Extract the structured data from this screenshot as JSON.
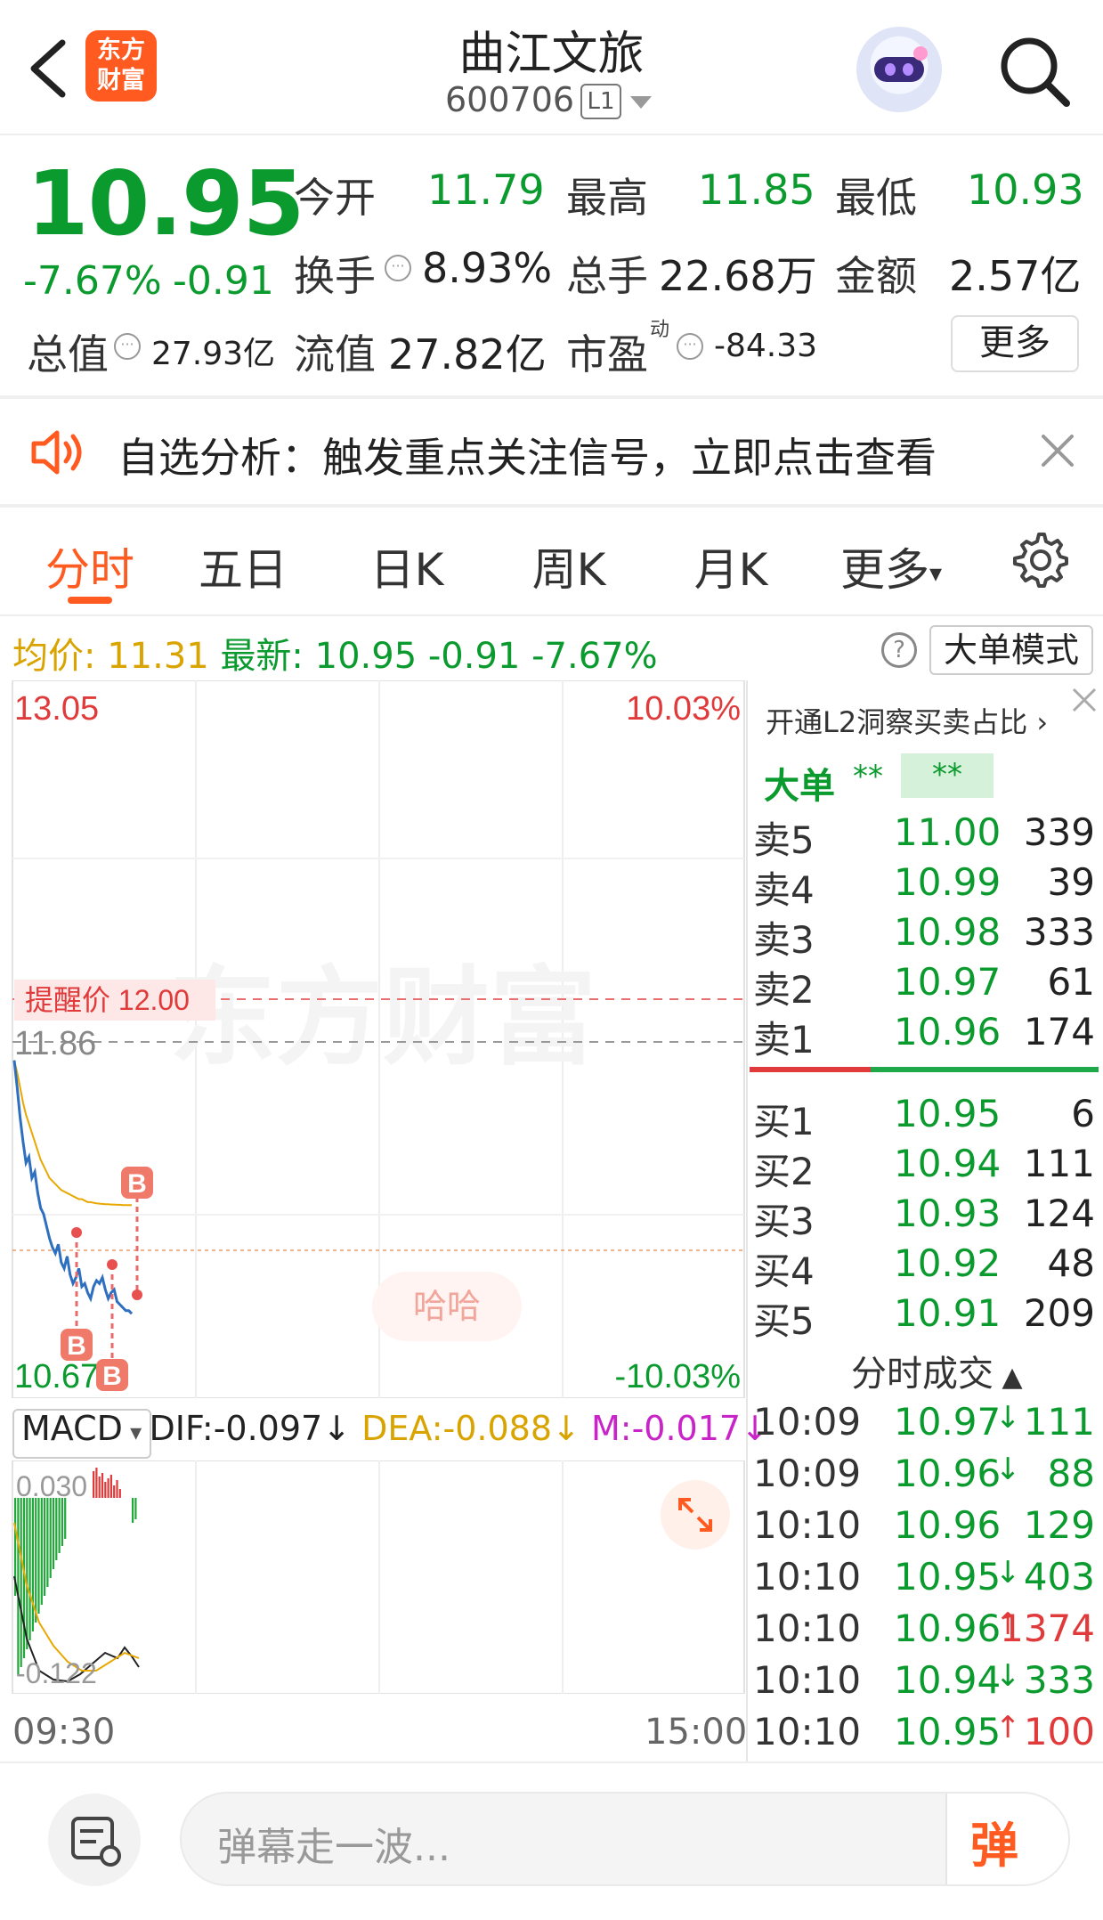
{
  "header": {
    "title": "曲江文旅",
    "code": "600706",
    "level": "L1",
    "logo_text_1": "东方",
    "logo_text_2": "财富"
  },
  "quote": {
    "price": "10.95",
    "change_pct": "-7.67%",
    "change_abs": "-0.91",
    "open_label": "今开",
    "open": "11.79",
    "high_label": "最高",
    "high": "11.85",
    "low_label": "最低",
    "low": "10.93",
    "turnover_label": "换手",
    "turnover": "8.93%",
    "volume_label": "总手",
    "volume": "22.68万",
    "amount_label": "金额",
    "amount": "2.57亿",
    "mktcap_label": "总值",
    "mktcap": "27.93亿",
    "float_label": "流值",
    "float": "27.82亿",
    "pe_label": "市盈",
    "pe_sup": "动",
    "pe": "-84.33",
    "more_label": "更多"
  },
  "alert": {
    "text": "自选分析：触发重点关注信号，立即点击查看"
  },
  "tabs": [
    "分时",
    "五日",
    "日K",
    "周K",
    "月K",
    "更多"
  ],
  "info": {
    "avg_label": "均价:",
    "avg": "11.31",
    "latest_label": "最新:",
    "latest": "10.95",
    "latest_chg": "-0.91",
    "latest_pct": "-7.67%",
    "mode_btn": "大单模式"
  },
  "chart": {
    "y_top": "13.05",
    "y_bottom": "10.67",
    "pct_top": "10.03%",
    "pct_bottom": "-10.03%",
    "alert_price_label": "提醒价 12.00",
    "prev_close_label": "11.86",
    "watermark": "东方财富",
    "haha_label": "哈哈",
    "marker_label": "B",
    "time_start": "09:30",
    "time_end": "15:00"
  },
  "chart_data": {
    "type": "line",
    "x": [
      "09:30",
      "09:31",
      "09:32",
      "09:33",
      "09:34",
      "09:35",
      "09:36",
      "09:37",
      "09:38",
      "09:39",
      "09:40",
      "09:41",
      "09:42",
      "09:43",
      "09:44",
      "09:45",
      "09:46",
      "09:47",
      "09:48",
      "09:49",
      "09:50",
      "09:51",
      "09:52",
      "09:53",
      "09:54",
      "09:55",
      "09:56",
      "09:57",
      "09:58",
      "09:59",
      "10:00",
      "10:01",
      "10:02",
      "10:03",
      "10:04",
      "10:05",
      "10:06",
      "10:07",
      "10:08",
      "10:09",
      "10:10"
    ],
    "series": [
      {
        "values": [
          11.79,
          11.7,
          11.6,
          11.52,
          11.45,
          11.47,
          11.4,
          11.42,
          11.35,
          11.3,
          11.28,
          11.24,
          11.2,
          11.17,
          11.15,
          11.18,
          11.12,
          11.1,
          11.14,
          11.08,
          11.05,
          11.07,
          11.1,
          11.04,
          11.05,
          11.02,
          11.0,
          11.04,
          11.06,
          11.05,
          11.07,
          11.03,
          11.0,
          11.02,
          11.03,
          10.99,
          10.98,
          10.97,
          10.96,
          10.96,
          10.95
        ]
      },
      {
        "values": [
          11.79,
          11.75,
          11.7,
          11.65,
          11.61,
          11.58,
          11.55,
          11.52,
          11.49,
          11.46,
          11.44,
          11.42,
          11.4,
          11.39,
          11.38,
          11.37,
          11.36,
          11.355,
          11.35,
          11.345,
          11.34,
          11.335,
          11.33,
          11.33,
          11.325,
          11.32,
          11.32,
          11.318,
          11.316,
          11.315,
          11.314,
          11.313,
          11.313,
          11.312,
          11.312,
          11.311,
          11.311,
          11.31,
          11.31,
          11.31,
          11.31
        ]
      }
    ],
    "ylim": [
      10.67,
      13.05
    ],
    "reference_lines": {
      "prev_close": 11.86,
      "alert_price": 12.0
    }
  },
  "macd": {
    "selector": "MACD",
    "dif": "DIF:-0.097",
    "dea": "DEA:-0.088",
    "m": "M:-0.017",
    "top": "0.030",
    "bottom": "-0.122"
  },
  "orderbook": {
    "header": "开通L2洞察买卖占比",
    "dadan_label": "大单",
    "dadan_v1": "**",
    "dadan_v2": "**",
    "asks": [
      {
        "label": "卖5",
        "price": "11.00",
        "vol": "339"
      },
      {
        "label": "卖4",
        "price": "10.99",
        "vol": "39"
      },
      {
        "label": "卖3",
        "price": "10.98",
        "vol": "333"
      },
      {
        "label": "卖2",
        "price": "10.97",
        "vol": "61"
      },
      {
        "label": "卖1",
        "price": "10.96",
        "vol": "174"
      }
    ],
    "bids": [
      {
        "label": "买1",
        "price": "10.95",
        "vol": "6"
      },
      {
        "label": "买2",
        "price": "10.94",
        "vol": "111"
      },
      {
        "label": "买3",
        "price": "10.93",
        "vol": "124"
      },
      {
        "label": "买4",
        "price": "10.92",
        "vol": "48"
      },
      {
        "label": "买5",
        "price": "10.91",
        "vol": "209"
      }
    ]
  },
  "trades": {
    "title": "分时成交",
    "rows": [
      {
        "time": "10:09",
        "price": "10.97",
        "dir": "↓",
        "vol": "111"
      },
      {
        "time": "10:09",
        "price": "10.96",
        "dir": "↓",
        "vol": "88"
      },
      {
        "time": "10:10",
        "price": "10.96",
        "dir": "",
        "vol": "129"
      },
      {
        "time": "10:10",
        "price": "10.95",
        "dir": "↓",
        "vol": "403"
      },
      {
        "time": "10:10",
        "price": "10.96",
        "dir": "↑",
        "vol": "1374"
      },
      {
        "time": "10:10",
        "price": "10.94",
        "dir": "↓",
        "vol": "333"
      },
      {
        "time": "10:10",
        "price": "10.95",
        "dir": "↑",
        "vol": "100"
      }
    ]
  },
  "bottom": {
    "placeholder": "弹幕走一波...",
    "send": "弹"
  },
  "colors": {
    "accent": "#ff5a1f",
    "down": "#0a9a2e",
    "up": "#e03a3a",
    "avg_line": "#e8a800",
    "price_line": "#2e6fbf"
  }
}
